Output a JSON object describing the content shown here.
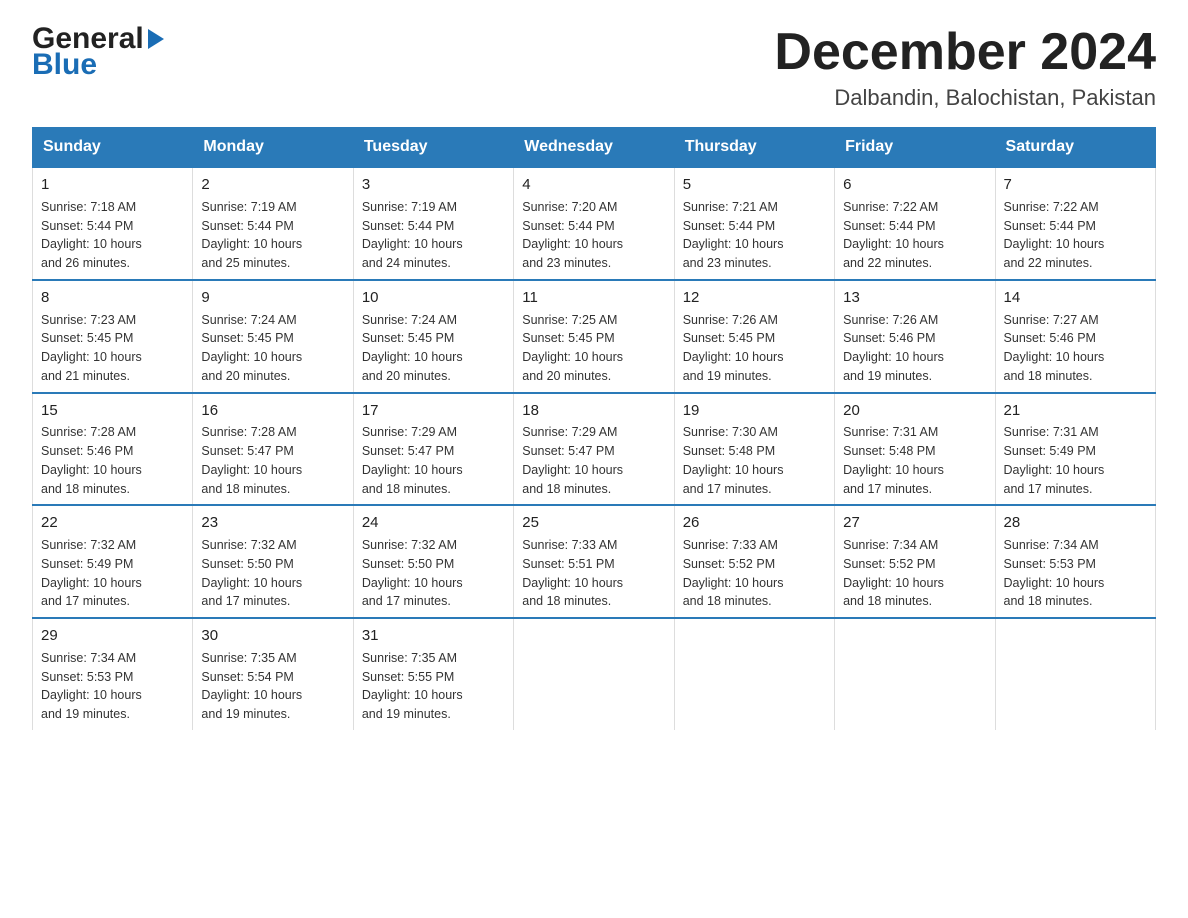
{
  "header": {
    "logo_line1": "General",
    "logo_line2": "Blue",
    "month_title": "December 2024",
    "location": "Dalbandin, Balochistan, Pakistan"
  },
  "calendar": {
    "days_of_week": [
      "Sunday",
      "Monday",
      "Tuesday",
      "Wednesday",
      "Thursday",
      "Friday",
      "Saturday"
    ],
    "weeks": [
      [
        {
          "day": "1",
          "sunrise": "7:18 AM",
          "sunset": "5:44 PM",
          "daylight": "10 hours and 26 minutes."
        },
        {
          "day": "2",
          "sunrise": "7:19 AM",
          "sunset": "5:44 PM",
          "daylight": "10 hours and 25 minutes."
        },
        {
          "day": "3",
          "sunrise": "7:19 AM",
          "sunset": "5:44 PM",
          "daylight": "10 hours and 24 minutes."
        },
        {
          "day": "4",
          "sunrise": "7:20 AM",
          "sunset": "5:44 PM",
          "daylight": "10 hours and 23 minutes."
        },
        {
          "day": "5",
          "sunrise": "7:21 AM",
          "sunset": "5:44 PM",
          "daylight": "10 hours and 23 minutes."
        },
        {
          "day": "6",
          "sunrise": "7:22 AM",
          "sunset": "5:44 PM",
          "daylight": "10 hours and 22 minutes."
        },
        {
          "day": "7",
          "sunrise": "7:22 AM",
          "sunset": "5:44 PM",
          "daylight": "10 hours and 22 minutes."
        }
      ],
      [
        {
          "day": "8",
          "sunrise": "7:23 AM",
          "sunset": "5:45 PM",
          "daylight": "10 hours and 21 minutes."
        },
        {
          "day": "9",
          "sunrise": "7:24 AM",
          "sunset": "5:45 PM",
          "daylight": "10 hours and 20 minutes."
        },
        {
          "day": "10",
          "sunrise": "7:24 AM",
          "sunset": "5:45 PM",
          "daylight": "10 hours and 20 minutes."
        },
        {
          "day": "11",
          "sunrise": "7:25 AM",
          "sunset": "5:45 PM",
          "daylight": "10 hours and 20 minutes."
        },
        {
          "day": "12",
          "sunrise": "7:26 AM",
          "sunset": "5:45 PM",
          "daylight": "10 hours and 19 minutes."
        },
        {
          "day": "13",
          "sunrise": "7:26 AM",
          "sunset": "5:46 PM",
          "daylight": "10 hours and 19 minutes."
        },
        {
          "day": "14",
          "sunrise": "7:27 AM",
          "sunset": "5:46 PM",
          "daylight": "10 hours and 18 minutes."
        }
      ],
      [
        {
          "day": "15",
          "sunrise": "7:28 AM",
          "sunset": "5:46 PM",
          "daylight": "10 hours and 18 minutes."
        },
        {
          "day": "16",
          "sunrise": "7:28 AM",
          "sunset": "5:47 PM",
          "daylight": "10 hours and 18 minutes."
        },
        {
          "day": "17",
          "sunrise": "7:29 AM",
          "sunset": "5:47 PM",
          "daylight": "10 hours and 18 minutes."
        },
        {
          "day": "18",
          "sunrise": "7:29 AM",
          "sunset": "5:47 PM",
          "daylight": "10 hours and 18 minutes."
        },
        {
          "day": "19",
          "sunrise": "7:30 AM",
          "sunset": "5:48 PM",
          "daylight": "10 hours and 17 minutes."
        },
        {
          "day": "20",
          "sunrise": "7:31 AM",
          "sunset": "5:48 PM",
          "daylight": "10 hours and 17 minutes."
        },
        {
          "day": "21",
          "sunrise": "7:31 AM",
          "sunset": "5:49 PM",
          "daylight": "10 hours and 17 minutes."
        }
      ],
      [
        {
          "day": "22",
          "sunrise": "7:32 AM",
          "sunset": "5:49 PM",
          "daylight": "10 hours and 17 minutes."
        },
        {
          "day": "23",
          "sunrise": "7:32 AM",
          "sunset": "5:50 PM",
          "daylight": "10 hours and 17 minutes."
        },
        {
          "day": "24",
          "sunrise": "7:32 AM",
          "sunset": "5:50 PM",
          "daylight": "10 hours and 17 minutes."
        },
        {
          "day": "25",
          "sunrise": "7:33 AM",
          "sunset": "5:51 PM",
          "daylight": "10 hours and 18 minutes."
        },
        {
          "day": "26",
          "sunrise": "7:33 AM",
          "sunset": "5:52 PM",
          "daylight": "10 hours and 18 minutes."
        },
        {
          "day": "27",
          "sunrise": "7:34 AM",
          "sunset": "5:52 PM",
          "daylight": "10 hours and 18 minutes."
        },
        {
          "day": "28",
          "sunrise": "7:34 AM",
          "sunset": "5:53 PM",
          "daylight": "10 hours and 18 minutes."
        }
      ],
      [
        {
          "day": "29",
          "sunrise": "7:34 AM",
          "sunset": "5:53 PM",
          "daylight": "10 hours and 19 minutes."
        },
        {
          "day": "30",
          "sunrise": "7:35 AM",
          "sunset": "5:54 PM",
          "daylight": "10 hours and 19 minutes."
        },
        {
          "day": "31",
          "sunrise": "7:35 AM",
          "sunset": "5:55 PM",
          "daylight": "10 hours and 19 minutes."
        },
        null,
        null,
        null,
        null
      ]
    ],
    "labels": {
      "sunrise": "Sunrise:",
      "sunset": "Sunset:",
      "daylight": "Daylight:"
    }
  }
}
